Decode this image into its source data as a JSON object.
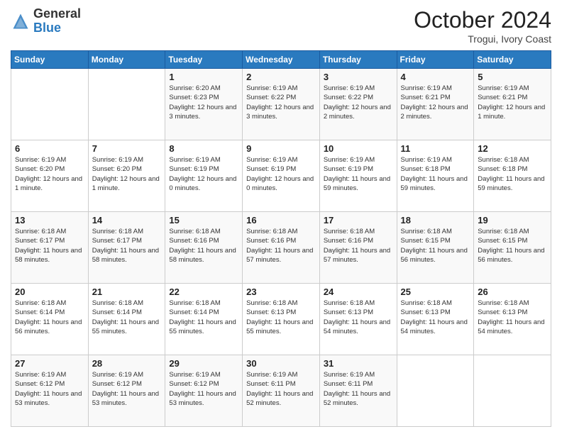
{
  "header": {
    "logo": {
      "line1": "General",
      "line2": "Blue"
    },
    "month": "October 2024",
    "location": "Trogui, Ivory Coast"
  },
  "weekdays": [
    "Sunday",
    "Monday",
    "Tuesday",
    "Wednesday",
    "Thursday",
    "Friday",
    "Saturday"
  ],
  "weeks": [
    [
      {
        "day": "",
        "info": ""
      },
      {
        "day": "",
        "info": ""
      },
      {
        "day": "1",
        "info": "Sunrise: 6:20 AM\nSunset: 6:23 PM\nDaylight: 12 hours and 3 minutes."
      },
      {
        "day": "2",
        "info": "Sunrise: 6:19 AM\nSunset: 6:22 PM\nDaylight: 12 hours and 3 minutes."
      },
      {
        "day": "3",
        "info": "Sunrise: 6:19 AM\nSunset: 6:22 PM\nDaylight: 12 hours and 2 minutes."
      },
      {
        "day": "4",
        "info": "Sunrise: 6:19 AM\nSunset: 6:21 PM\nDaylight: 12 hours and 2 minutes."
      },
      {
        "day": "5",
        "info": "Sunrise: 6:19 AM\nSunset: 6:21 PM\nDaylight: 12 hours and 1 minute."
      }
    ],
    [
      {
        "day": "6",
        "info": "Sunrise: 6:19 AM\nSunset: 6:20 PM\nDaylight: 12 hours and 1 minute."
      },
      {
        "day": "7",
        "info": "Sunrise: 6:19 AM\nSunset: 6:20 PM\nDaylight: 12 hours and 1 minute."
      },
      {
        "day": "8",
        "info": "Sunrise: 6:19 AM\nSunset: 6:19 PM\nDaylight: 12 hours and 0 minutes."
      },
      {
        "day": "9",
        "info": "Sunrise: 6:19 AM\nSunset: 6:19 PM\nDaylight: 12 hours and 0 minutes."
      },
      {
        "day": "10",
        "info": "Sunrise: 6:19 AM\nSunset: 6:19 PM\nDaylight: 11 hours and 59 minutes."
      },
      {
        "day": "11",
        "info": "Sunrise: 6:19 AM\nSunset: 6:18 PM\nDaylight: 11 hours and 59 minutes."
      },
      {
        "day": "12",
        "info": "Sunrise: 6:18 AM\nSunset: 6:18 PM\nDaylight: 11 hours and 59 minutes."
      }
    ],
    [
      {
        "day": "13",
        "info": "Sunrise: 6:18 AM\nSunset: 6:17 PM\nDaylight: 11 hours and 58 minutes."
      },
      {
        "day": "14",
        "info": "Sunrise: 6:18 AM\nSunset: 6:17 PM\nDaylight: 11 hours and 58 minutes."
      },
      {
        "day": "15",
        "info": "Sunrise: 6:18 AM\nSunset: 6:16 PM\nDaylight: 11 hours and 58 minutes."
      },
      {
        "day": "16",
        "info": "Sunrise: 6:18 AM\nSunset: 6:16 PM\nDaylight: 11 hours and 57 minutes."
      },
      {
        "day": "17",
        "info": "Sunrise: 6:18 AM\nSunset: 6:16 PM\nDaylight: 11 hours and 57 minutes."
      },
      {
        "day": "18",
        "info": "Sunrise: 6:18 AM\nSunset: 6:15 PM\nDaylight: 11 hours and 56 minutes."
      },
      {
        "day": "19",
        "info": "Sunrise: 6:18 AM\nSunset: 6:15 PM\nDaylight: 11 hours and 56 minutes."
      }
    ],
    [
      {
        "day": "20",
        "info": "Sunrise: 6:18 AM\nSunset: 6:14 PM\nDaylight: 11 hours and 56 minutes."
      },
      {
        "day": "21",
        "info": "Sunrise: 6:18 AM\nSunset: 6:14 PM\nDaylight: 11 hours and 55 minutes."
      },
      {
        "day": "22",
        "info": "Sunrise: 6:18 AM\nSunset: 6:14 PM\nDaylight: 11 hours and 55 minutes."
      },
      {
        "day": "23",
        "info": "Sunrise: 6:18 AM\nSunset: 6:13 PM\nDaylight: 11 hours and 55 minutes."
      },
      {
        "day": "24",
        "info": "Sunrise: 6:18 AM\nSunset: 6:13 PM\nDaylight: 11 hours and 54 minutes."
      },
      {
        "day": "25",
        "info": "Sunrise: 6:18 AM\nSunset: 6:13 PM\nDaylight: 11 hours and 54 minutes."
      },
      {
        "day": "26",
        "info": "Sunrise: 6:18 AM\nSunset: 6:13 PM\nDaylight: 11 hours and 54 minutes."
      }
    ],
    [
      {
        "day": "27",
        "info": "Sunrise: 6:19 AM\nSunset: 6:12 PM\nDaylight: 11 hours and 53 minutes."
      },
      {
        "day": "28",
        "info": "Sunrise: 6:19 AM\nSunset: 6:12 PM\nDaylight: 11 hours and 53 minutes."
      },
      {
        "day": "29",
        "info": "Sunrise: 6:19 AM\nSunset: 6:12 PM\nDaylight: 11 hours and 53 minutes."
      },
      {
        "day": "30",
        "info": "Sunrise: 6:19 AM\nSunset: 6:11 PM\nDaylight: 11 hours and 52 minutes."
      },
      {
        "day": "31",
        "info": "Sunrise: 6:19 AM\nSunset: 6:11 PM\nDaylight: 11 hours and 52 minutes."
      },
      {
        "day": "",
        "info": ""
      },
      {
        "day": "",
        "info": ""
      }
    ]
  ]
}
